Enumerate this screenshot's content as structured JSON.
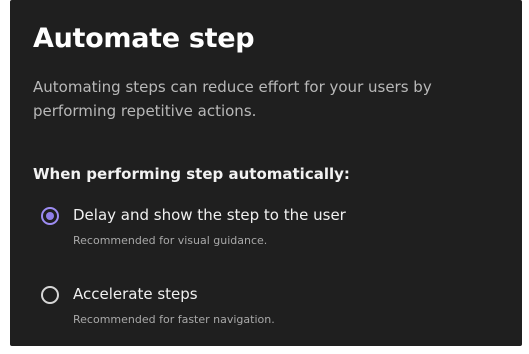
{
  "dialog": {
    "title": "Automate step",
    "description": "Automating steps can reduce effort for your users by performing repetitive actions.",
    "section_heading": "When performing step automatically:",
    "options": [
      {
        "label": "Delay and show the step to the user",
        "hint": "Recommended for visual guidance.",
        "selected": true
      },
      {
        "label": "Accelerate steps",
        "hint": "Recommended for faster navigation.",
        "selected": false
      }
    ]
  },
  "colors": {
    "panel_background": "#1f1f1f",
    "accent": "#8f7ee8",
    "title_text": "#ffffff",
    "secondary_text": "#b8b8b8"
  },
  "icons": {
    "selected_option": "radio-checked-icon",
    "unselected_option": "radio-unchecked-icon"
  }
}
